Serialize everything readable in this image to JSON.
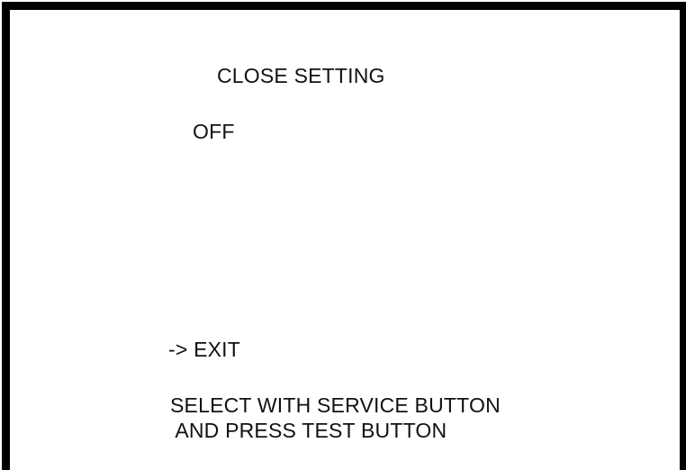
{
  "menu": {
    "title": "CLOSE SETTING",
    "setting_value": "OFF",
    "exit_item": "-> EXIT",
    "instruction_line1": "SELECT WITH SERVICE BUTTON",
    "instruction_line2": " AND PRESS TEST BUTTON"
  },
  "colors": {
    "background": "#ffffff",
    "frame": "#000000",
    "text": "#111111"
  }
}
